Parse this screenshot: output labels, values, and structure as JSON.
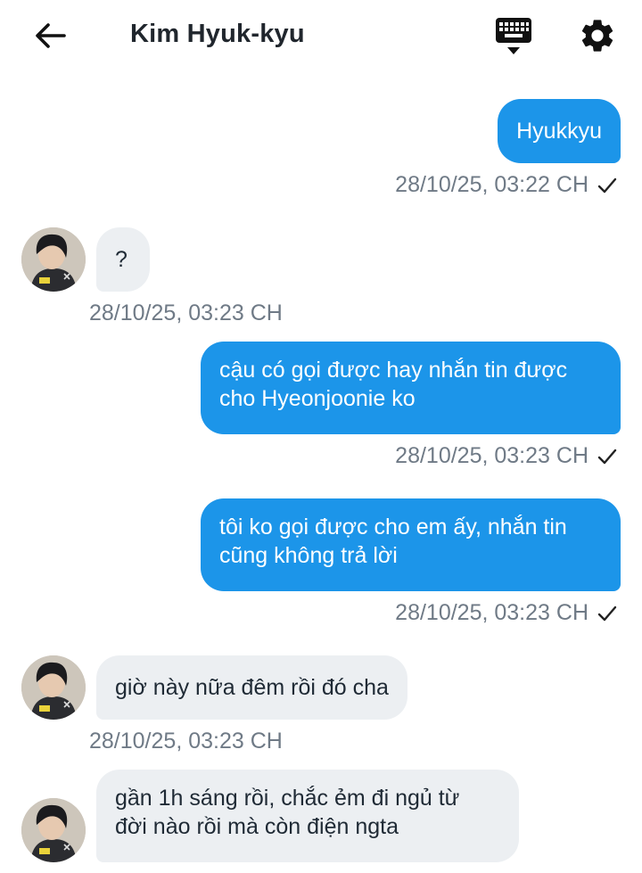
{
  "header": {
    "title": "Kim Hyuk-kyu",
    "back_icon": "arrow-left-icon",
    "keyboard_icon": "keyboard-icon",
    "settings_icon": "gear-icon"
  },
  "colors": {
    "outgoing_bubble": "#1c95e9",
    "incoming_bubble": "#eceff2",
    "timestamp": "#6f7a86"
  },
  "messages": [
    {
      "direction": "outgoing",
      "text": "Hyukkyu",
      "time": "28/10/25, 03:22 CH",
      "status_icon": "check-icon"
    },
    {
      "direction": "incoming",
      "text": "?",
      "time": "28/10/25, 03:23 CH"
    },
    {
      "direction": "outgoing",
      "text": "cậu có gọi được hay nhắn tin được\ncho Hyeonjoonie ko",
      "time": "28/10/25, 03:23 CH",
      "status_icon": "check-icon"
    },
    {
      "direction": "outgoing",
      "text": "tôi ko gọi được cho em ấy, nhắn tin\ncũng không trả lời",
      "time": "28/10/25, 03:23 CH",
      "status_icon": "check-icon"
    },
    {
      "direction": "incoming",
      "text": "giờ này nữa đêm rồi đó cha",
      "time": "28/10/25, 03:23 CH"
    },
    {
      "direction": "incoming",
      "text": "gần 1h sáng rồi, chắc ẻm đi ngủ từ\nđời nào rồi mà còn điện ngta",
      "time": ""
    }
  ]
}
